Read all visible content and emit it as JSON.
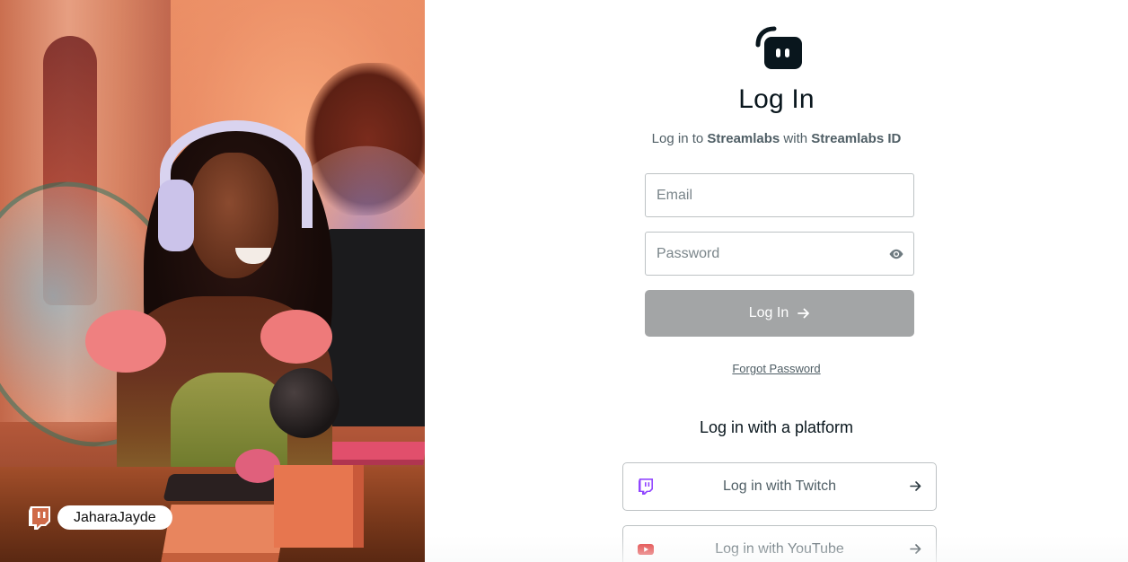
{
  "hero": {
    "creator_name": "JaharaJayde",
    "creator_platform_icon": "twitch-icon"
  },
  "login": {
    "logo_icon": "streamlabs-logo-icon",
    "title": "Log In",
    "subtitle_prefix": "Log in to ",
    "subtitle_brand": "Streamlabs",
    "subtitle_middle": " with ",
    "subtitle_id": "Streamlabs ID",
    "email_placeholder": "Email",
    "password_placeholder": "Password",
    "password_toggle_icon": "eye-icon",
    "submit_label": "Log In",
    "submit_icon": "arrow-right-icon",
    "forgot_label": "Forgot Password"
  },
  "platforms": {
    "heading": "Log in with a platform",
    "items": [
      {
        "label": "Log in with Twitch",
        "icon": "twitch-icon",
        "color": "#9146ff"
      },
      {
        "label": "Log in with YouTube",
        "icon": "youtube-icon",
        "color": "#e02f2f"
      }
    ]
  },
  "colors": {
    "text_primary": "#09161d",
    "text_secondary": "#4f5e65",
    "button_disabled": "#a3a5a6",
    "border": "#bdc2c4"
  }
}
